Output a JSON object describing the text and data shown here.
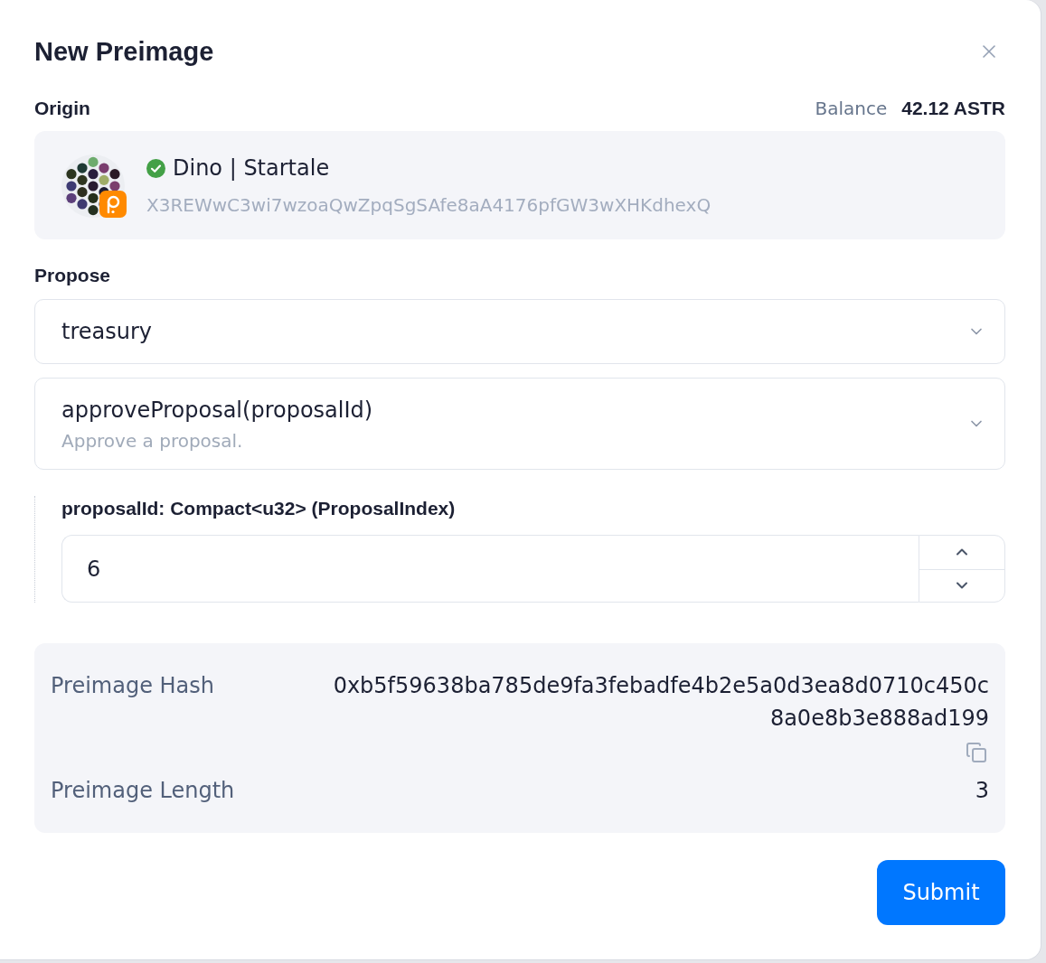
{
  "dialog": {
    "title": "New Preimage"
  },
  "origin": {
    "label": "Origin",
    "balance_label": "Balance",
    "balance": "42.12 ASTR",
    "account": {
      "name": "Dino | Startale",
      "verified": true,
      "address": "X3REWwC3wi7wzoaQwZpqSgSAfe8aA4176pfGW3wXHKdhexQ"
    }
  },
  "propose": {
    "label": "Propose",
    "pallet": "treasury",
    "call": {
      "name": "approveProposal(proposalId)",
      "description": "Approve a proposal."
    },
    "params": [
      {
        "label": "proposalId: Compact<u32> (ProposalIndex)",
        "value": "6"
      }
    ]
  },
  "preimage": [
    {
      "label": "Preimage Hash",
      "value": "0xb5f59638ba785de9fa3febadfe4b2e5a0d3ea8d0710c450c8a0e8b3e888ad199",
      "copyable": true
    },
    {
      "label": "Preimage Length",
      "value": "3",
      "copyable": false
    }
  ],
  "submit": "Submit"
}
